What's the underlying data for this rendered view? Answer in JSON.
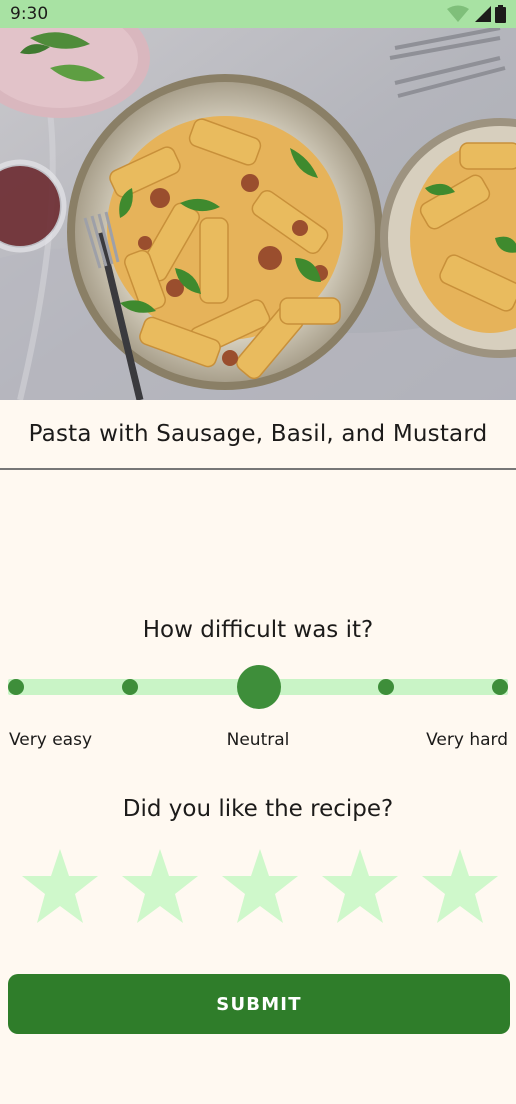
{
  "status_bar": {
    "time": "9:30",
    "icons": [
      "wifi-icon",
      "cell-signal-icon",
      "battery-icon"
    ]
  },
  "recipe": {
    "title": "Pasta with Sausage, Basil, and Mustard",
    "image_icon": "pasta-dish-photo"
  },
  "difficulty": {
    "question": "How difficult was it?",
    "labels": {
      "left": "Very easy",
      "center": "Neutral",
      "right": "Very hard"
    },
    "steps": 5,
    "selected_step": 3
  },
  "rating": {
    "question": "Did you like the recipe?",
    "max_stars": 5,
    "selected": 0,
    "star_icon": "star-icon"
  },
  "actions": {
    "submit_label": "SUBMIT"
  },
  "colors": {
    "status_bar": "#A8E2A3",
    "background": "#FFF9F1",
    "accent": "#3E8E3A",
    "track": "#C9F4C6",
    "star_empty": "#CFF8CB",
    "button": "#2F7D2A"
  }
}
